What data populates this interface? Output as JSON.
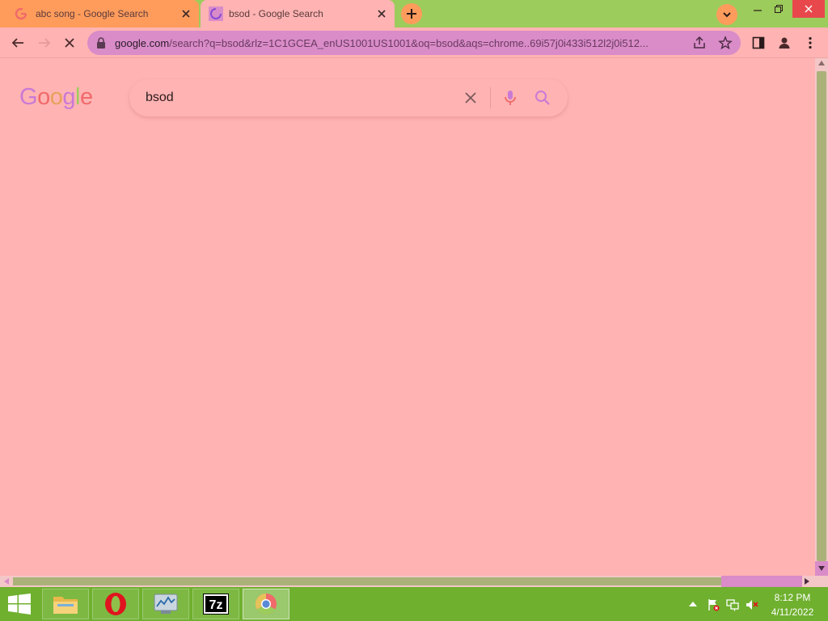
{
  "browser": {
    "tabs": [
      {
        "title": "abc song - Google Search",
        "state": "inactive"
      },
      {
        "title": "bsod - Google Search",
        "state": "active-loading"
      }
    ],
    "address_bar": {
      "domain": "google.com",
      "path": "/search?q=bsod&rlz=1C1GCEA_enUS1001US1001&oq=bsod&aqs=chrome..69i57j0i433i512l2j0i512..."
    },
    "icons": [
      "back-arrow-icon",
      "forward-arrow-icon",
      "stop-icon",
      "lock-icon",
      "share-icon",
      "star-icon",
      "side-panel-icon",
      "profile-icon",
      "kebab-menu-icon"
    ]
  },
  "page": {
    "logo_letters": [
      "G",
      "o",
      "o",
      "g",
      "l",
      "e"
    ],
    "search_query": "bsod"
  },
  "taskbar": {
    "apps": [
      "file-explorer",
      "opera",
      "performance-monitor",
      "7-zip",
      "chrome"
    ],
    "sevenzip_label": "7z",
    "clock_time": "8:12 PM",
    "clock_date": "4/11/2022"
  },
  "colors": {
    "tab_strip": "#9ccc5c",
    "inactive_tab": "#ff9c5c",
    "page_background": "#ffb3b3",
    "omnibox": "#d98cc8",
    "taskbar": "#6fb02e",
    "close_button": "#e8484c"
  }
}
